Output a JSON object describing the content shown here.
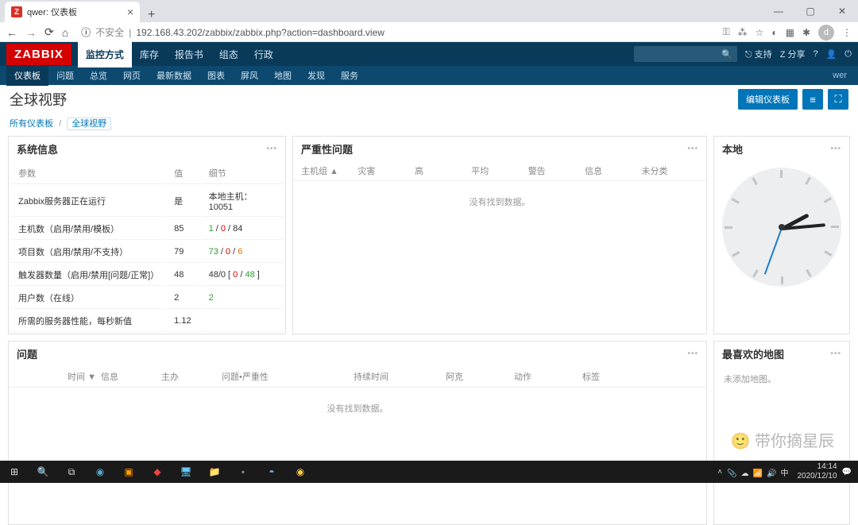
{
  "browser": {
    "tab_title": "qwer: 仪表板",
    "insecure_label": "不安全",
    "url": "192.168.43.202/zabbix/zabbix.php?action=dashboard.view",
    "avatar": "d"
  },
  "header": {
    "logo": "ZABBIX",
    "main_nav": [
      "监控方式",
      "库存",
      "报告书",
      "组态",
      "行政"
    ],
    "support": "⎋ 支持",
    "share": "Z 分享",
    "sub_nav": [
      "仪表板",
      "问题",
      "总览",
      "网页",
      "最新数据",
      "图表",
      "屏风",
      "地图",
      "发现",
      "服务"
    ],
    "user": "wer"
  },
  "page": {
    "title": "全球视野",
    "edit_btn": "编辑仪表板",
    "breadcrumb_all": "所有仪表板",
    "breadcrumb_current": "全球视野"
  },
  "sysinfo": {
    "title": "系统信息",
    "cols": [
      "参数",
      "值",
      "细节"
    ],
    "rows": [
      {
        "param": "Zabbix服务器正在运行",
        "val": "是",
        "val_cls": "green",
        "detail": "本地主机：10051"
      },
      {
        "param": "主机数（启用/禁用/模板）",
        "val": "85",
        "detail_parts": [
          {
            "t": "1",
            "c": "green"
          },
          {
            "t": " / "
          },
          {
            "t": "0",
            "c": "red"
          },
          {
            "t": " / "
          },
          {
            "t": "84",
            "c": ""
          }
        ]
      },
      {
        "param": "项目数（启用/禁用/不支持）",
        "val": "79",
        "detail_parts": [
          {
            "t": "73",
            "c": "green"
          },
          {
            "t": " / "
          },
          {
            "t": "0",
            "c": "red"
          },
          {
            "t": " / "
          },
          {
            "t": "6",
            "c": "orange"
          }
        ]
      },
      {
        "param": "触发器数量（启用/禁用[问题/正常]）",
        "val": "48",
        "detail_parts": [
          {
            "t": "48/0 [ "
          },
          {
            "t": "0",
            "c": "red"
          },
          {
            "t": " / "
          },
          {
            "t": "48",
            "c": "green"
          },
          {
            "t": " ]"
          }
        ]
      },
      {
        "param": "用户数（在线）",
        "val": "2",
        "detail_parts": [
          {
            "t": "2",
            "c": "green"
          }
        ]
      },
      {
        "param": "所需的服务器性能，每秒新值",
        "val": "1.12",
        "detail": ""
      }
    ]
  },
  "severity": {
    "title": "严重性问题",
    "cols": [
      "主机组 ▲",
      "灾害",
      "高",
      "平均",
      "警告",
      "信息",
      "未分类"
    ],
    "nodata": "没有找到数据。"
  },
  "clock": {
    "title": "本地"
  },
  "problems": {
    "title": "问题",
    "cols": [
      "时间 ▼",
      "信息",
      "主办",
      "问题•严重性",
      "持续时间",
      "阿克",
      "动作",
      "标签"
    ],
    "nodata": "没有找到数据。"
  },
  "favmaps": {
    "title": "最喜欢的地图",
    "nodata": "未添加地图。"
  },
  "taskbar": {
    "time": "14:14",
    "date": "2020/12/10",
    "tray_icons": [
      "📎",
      "☁",
      "📶",
      "🔊",
      "中"
    ]
  },
  "watermark": "🙂 带你摘星辰"
}
